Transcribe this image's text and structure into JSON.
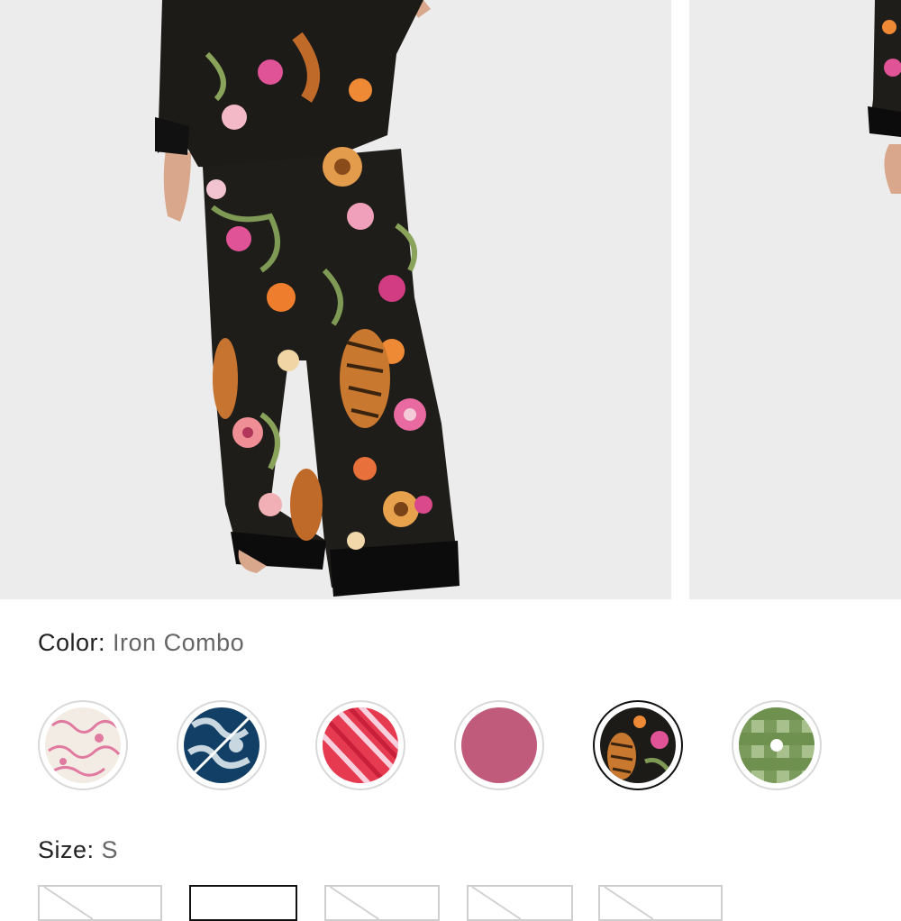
{
  "product": {
    "color_label": "Color:",
    "color_value": "Iron Combo",
    "size_label": "Size:",
    "size_value": "S"
  },
  "images": {
    "main_alt": "model wearing floral tiger print pajama set",
    "next_alt": "alternate product view"
  },
  "swatches": [
    {
      "name": "pink toile",
      "selected": false
    },
    {
      "name": "blue print",
      "selected": false
    },
    {
      "name": "red stripe",
      "selected": false
    },
    {
      "name": "pink solid",
      "selected": false
    },
    {
      "name": "iron combo",
      "selected": true
    },
    {
      "name": "green gingham",
      "selected": false
    }
  ],
  "colors": {
    "text": "#222222",
    "muted": "#666666",
    "selected_border": "#111111",
    "swatch_border": "#d9d9d9"
  }
}
